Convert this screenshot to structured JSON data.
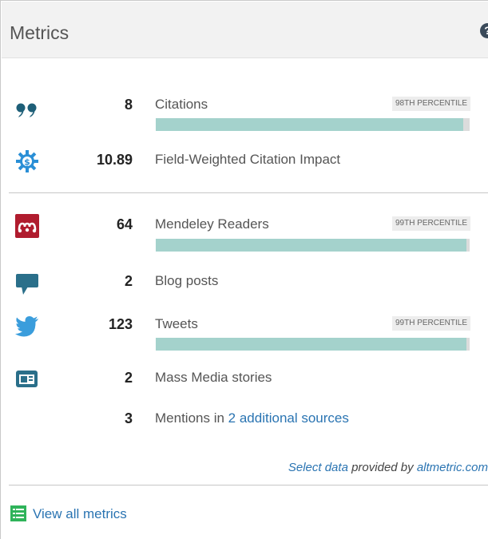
{
  "header": {
    "title": "Metrics",
    "help_glyph": "?"
  },
  "metrics": [
    {
      "icon": "citations-quote-icon",
      "count": "8",
      "label": "Citations",
      "percentile": "98TH PERCENTILE",
      "bar_fraction": 0.98,
      "color": "#1e5f78"
    },
    {
      "icon": "fwci-gear-icon",
      "count": "10.89",
      "label": "Field-Weighted Citation Impact",
      "color": "#2a8fd6"
    },
    {
      "icon": "mendeley-icon",
      "count": "64",
      "label": "Mendeley Readers",
      "percentile": "99TH PERCENTILE",
      "bar_fraction": 0.99,
      "color": "#b01c2e"
    },
    {
      "icon": "blog-speech-icon",
      "count": "2",
      "label": "Blog posts",
      "color": "#2a6f8a"
    },
    {
      "icon": "twitter-bird-icon",
      "count": "123",
      "label": "Tweets",
      "percentile": "99TH PERCENTILE",
      "bar_fraction": 0.99,
      "color": "#3a9ddc"
    },
    {
      "icon": "news-icon",
      "count": "2",
      "label": "Mass Media stories",
      "color": "#2a6f8a"
    },
    {
      "count": "3",
      "label_prefix": "Mentions in ",
      "label_link": "2 additional sources"
    }
  ],
  "credit": {
    "link1": "Select data",
    "middle": " provided by ",
    "link2": "altmetric.com"
  },
  "footer": {
    "view_all": "View all metrics"
  },
  "colors": {
    "bar_fill": "#a4d2cc",
    "bar_track": "#dcdcdc",
    "link": "#2a74b2"
  }
}
